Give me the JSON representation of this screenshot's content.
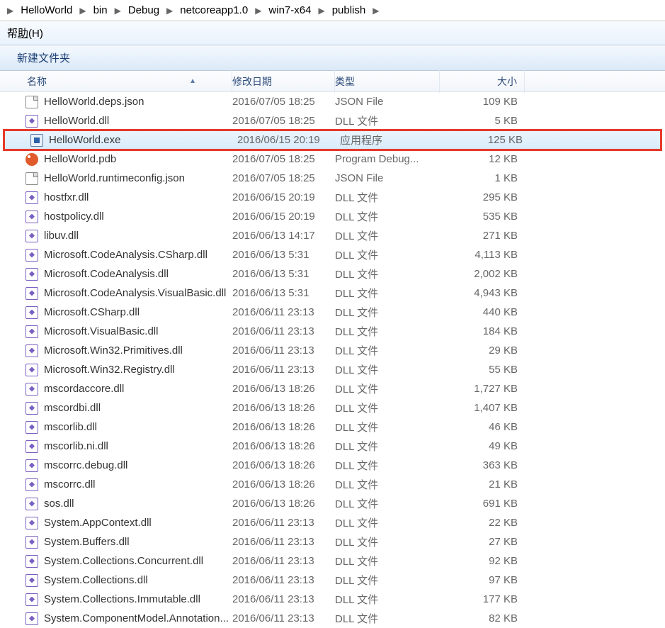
{
  "breadcrumbs": [
    "HelloWorld",
    "bin",
    "Debug",
    "netcoreapp1.0",
    "win7-x64",
    "publish"
  ],
  "menu": {
    "help_prefix": "帮",
    "help_accel": "助",
    "help_suffix": "(H)"
  },
  "toolbar": {
    "newfolder": "新建文件夹"
  },
  "columns": {
    "name": "名称",
    "date": "修改日期",
    "type": "类型",
    "size": "大小"
  },
  "unit": "KB",
  "selected_index": 2,
  "highlight_index": 2,
  "files": [
    {
      "name": "HelloWorld.deps.json",
      "date": "2016/07/05 18:25",
      "type": "JSON File",
      "size": "109",
      "icon": "json"
    },
    {
      "name": "HelloWorld.dll",
      "date": "2016/07/05 18:25",
      "type": "DLL 文件",
      "size": "5",
      "icon": "dll"
    },
    {
      "name": "HelloWorld.exe",
      "date": "2016/06/15 20:19",
      "type": "应用程序",
      "size": "125",
      "icon": "exe"
    },
    {
      "name": "HelloWorld.pdb",
      "date": "2016/07/05 18:25",
      "type": "Program Debug...",
      "size": "12",
      "icon": "pdb"
    },
    {
      "name": "HelloWorld.runtimeconfig.json",
      "date": "2016/07/05 18:25",
      "type": "JSON File",
      "size": "1",
      "icon": "json"
    },
    {
      "name": "hostfxr.dll",
      "date": "2016/06/15 20:19",
      "type": "DLL 文件",
      "size": "295",
      "icon": "dll"
    },
    {
      "name": "hostpolicy.dll",
      "date": "2016/06/15 20:19",
      "type": "DLL 文件",
      "size": "535",
      "icon": "dll"
    },
    {
      "name": "libuv.dll",
      "date": "2016/06/13 14:17",
      "type": "DLL 文件",
      "size": "271",
      "icon": "dll"
    },
    {
      "name": "Microsoft.CodeAnalysis.CSharp.dll",
      "date": "2016/06/13 5:31",
      "type": "DLL 文件",
      "size": "4,113",
      "icon": "dll"
    },
    {
      "name": "Microsoft.CodeAnalysis.dll",
      "date": "2016/06/13 5:31",
      "type": "DLL 文件",
      "size": "2,002",
      "icon": "dll"
    },
    {
      "name": "Microsoft.CodeAnalysis.VisualBasic.dll",
      "date": "2016/06/13 5:31",
      "type": "DLL 文件",
      "size": "4,943",
      "icon": "dll"
    },
    {
      "name": "Microsoft.CSharp.dll",
      "date": "2016/06/11 23:13",
      "type": "DLL 文件",
      "size": "440",
      "icon": "dll"
    },
    {
      "name": "Microsoft.VisualBasic.dll",
      "date": "2016/06/11 23:13",
      "type": "DLL 文件",
      "size": "184",
      "icon": "dll"
    },
    {
      "name": "Microsoft.Win32.Primitives.dll",
      "date": "2016/06/11 23:13",
      "type": "DLL 文件",
      "size": "29",
      "icon": "dll"
    },
    {
      "name": "Microsoft.Win32.Registry.dll",
      "date": "2016/06/11 23:13",
      "type": "DLL 文件",
      "size": "55",
      "icon": "dll"
    },
    {
      "name": "mscordaccore.dll",
      "date": "2016/06/13 18:26",
      "type": "DLL 文件",
      "size": "1,727",
      "icon": "dll"
    },
    {
      "name": "mscordbi.dll",
      "date": "2016/06/13 18:26",
      "type": "DLL 文件",
      "size": "1,407",
      "icon": "dll"
    },
    {
      "name": "mscorlib.dll",
      "date": "2016/06/13 18:26",
      "type": "DLL 文件",
      "size": "46",
      "icon": "dll"
    },
    {
      "name": "mscorlib.ni.dll",
      "date": "2016/06/13 18:26",
      "type": "DLL 文件",
      "size": "49",
      "icon": "dll"
    },
    {
      "name": "mscorrc.debug.dll",
      "date": "2016/06/13 18:26",
      "type": "DLL 文件",
      "size": "363",
      "icon": "dll"
    },
    {
      "name": "mscorrc.dll",
      "date": "2016/06/13 18:26",
      "type": "DLL 文件",
      "size": "21",
      "icon": "dll"
    },
    {
      "name": "sos.dll",
      "date": "2016/06/13 18:26",
      "type": "DLL 文件",
      "size": "691",
      "icon": "dll"
    },
    {
      "name": "System.AppContext.dll",
      "date": "2016/06/11 23:13",
      "type": "DLL 文件",
      "size": "22",
      "icon": "dll"
    },
    {
      "name": "System.Buffers.dll",
      "date": "2016/06/11 23:13",
      "type": "DLL 文件",
      "size": "27",
      "icon": "dll"
    },
    {
      "name": "System.Collections.Concurrent.dll",
      "date": "2016/06/11 23:13",
      "type": "DLL 文件",
      "size": "92",
      "icon": "dll"
    },
    {
      "name": "System.Collections.dll",
      "date": "2016/06/11 23:13",
      "type": "DLL 文件",
      "size": "97",
      "icon": "dll"
    },
    {
      "name": "System.Collections.Immutable.dll",
      "date": "2016/06/11 23:13",
      "type": "DLL 文件",
      "size": "177",
      "icon": "dll"
    },
    {
      "name": "System.ComponentModel.Annotation...",
      "date": "2016/06/11 23:13",
      "type": "DLL 文件",
      "size": "82",
      "icon": "dll"
    }
  ]
}
